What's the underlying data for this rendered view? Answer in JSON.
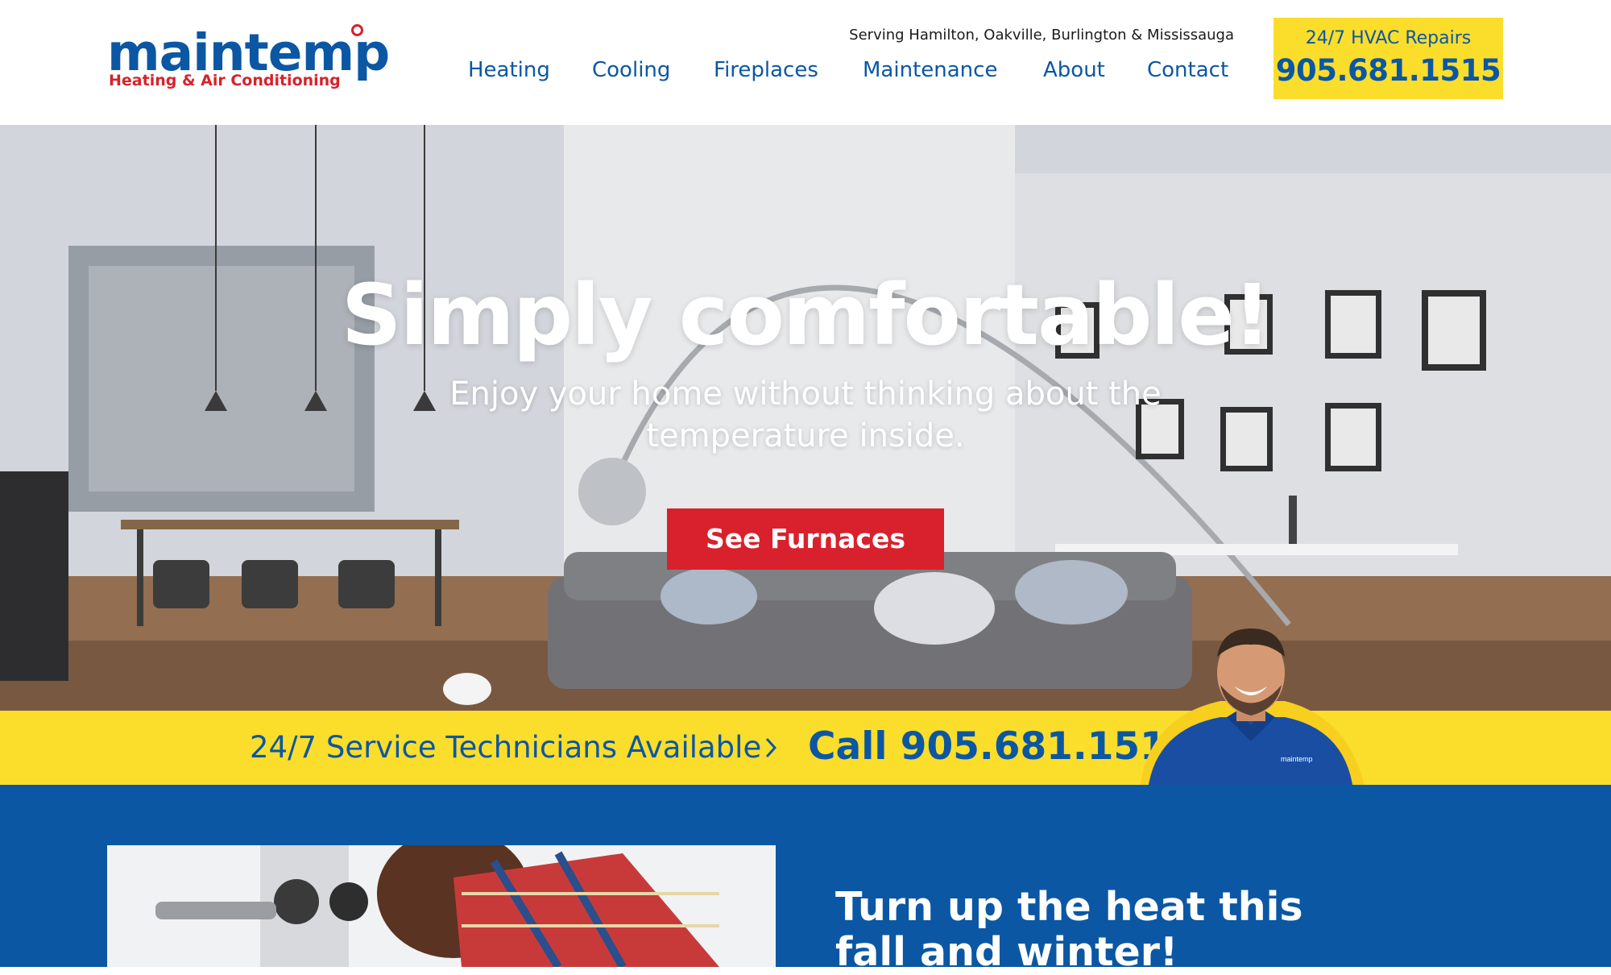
{
  "brand": {
    "name": "maintemp",
    "tagline": "Heating & Air Conditioning",
    "blue": "#0b57a4",
    "red": "#d8212c",
    "yellow": "#fbdd2b"
  },
  "header": {
    "service_area": "Serving Hamilton, Oakville, Burlington & Mississauga",
    "nav": [
      {
        "label": "Heating"
      },
      {
        "label": "Cooling"
      },
      {
        "label": "Fireplaces"
      },
      {
        "label": "Maintenance"
      },
      {
        "label": "About"
      },
      {
        "label": "Contact"
      }
    ],
    "phone_box": {
      "label": "24/7 HVAC Repairs",
      "number": "905.681.1515"
    }
  },
  "hero": {
    "title": "Simply comfortable!",
    "subtitle": "Enjoy your home without thinking about the temperature inside.",
    "cta_label": "See Furnaces"
  },
  "band": {
    "text": "24/7 Service Technicians Available",
    "call": "Call 905.681.1515",
    "shirt_logo": "maintemp"
  },
  "promo": {
    "heading": "Turn up the heat this fall and winter!"
  }
}
